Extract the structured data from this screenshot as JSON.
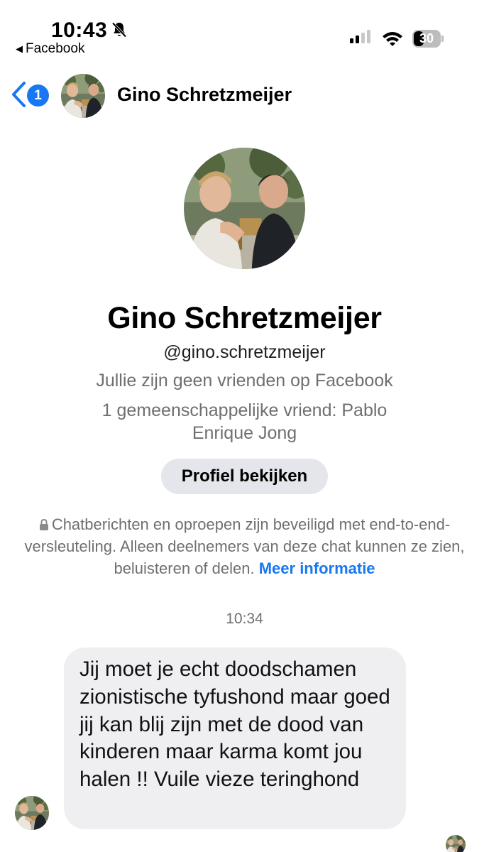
{
  "status_bar": {
    "time": "10:43",
    "back_app": "Facebook",
    "battery": "30",
    "icons": [
      "bell-slash-icon",
      "cellular-signal-icon",
      "wifi-icon",
      "battery-icon"
    ]
  },
  "header": {
    "unread_count": "1",
    "contact_name": "Gino Schretzmeijer"
  },
  "profile": {
    "name": "Gino Schretzmeijer",
    "handle": "@gino.schretzmeijer",
    "friend_status": "Jullie zijn geen vrienden op Facebook",
    "mutual_friends": "1 gemeenschappelijke vriend: Pablo Enrique Jong",
    "view_profile_label": "Profiel bekijken"
  },
  "encryption_notice": {
    "text": "Chatberichten en oproepen zijn beveiligd met end-to-end-versleuteling. Alleen deelnemers van deze chat kunnen ze zien, beluisteren of delen.",
    "link": "Meer informatie"
  },
  "conversation": {
    "timestamp": "10:34",
    "messages": [
      {
        "direction": "incoming",
        "text": "Jij moet je echt doodschamen zionistische tyfushond maar goed jij kan blij zijn met de dood van kinderen maar karma komt jou halen !! Vuile vieze teringhond"
      }
    ]
  },
  "colors": {
    "accent": "#1877f2",
    "bubble_incoming": "#efeff2",
    "secondary_text": "#6f6f73",
    "button_bg": "#e4e6eb"
  }
}
